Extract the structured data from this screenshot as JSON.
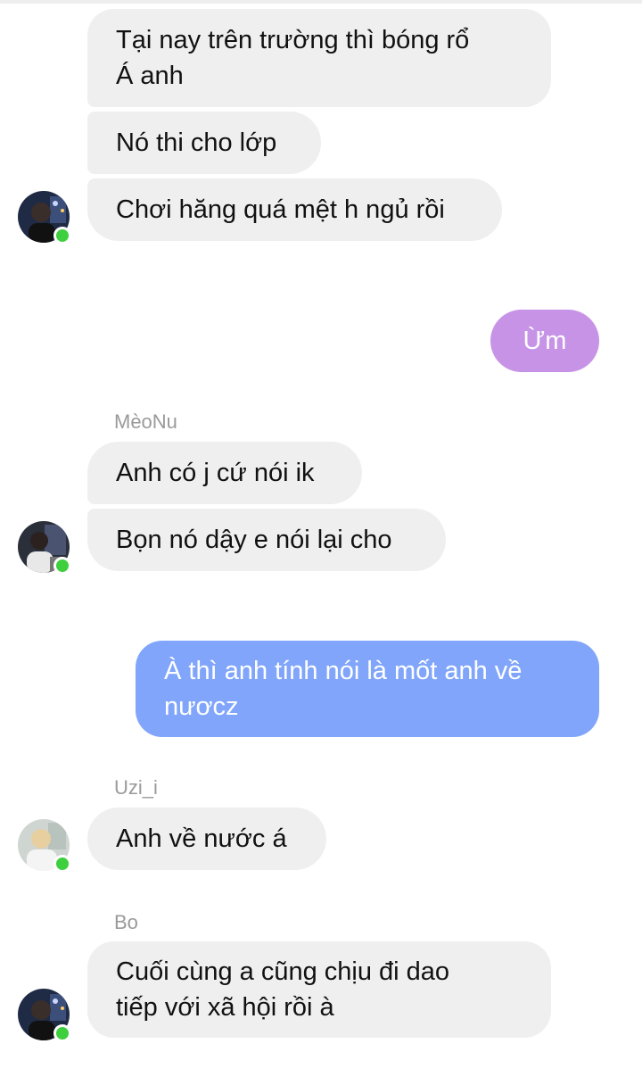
{
  "colors": {
    "incoming_bubble": "#efefef",
    "outgoing_purple": "#c793e6",
    "outgoing_blue": "#80a5fa",
    "online_dot": "#3ecf3e",
    "sender_name": "#9a9a9a"
  },
  "messages": {
    "m1": {
      "line1": "Tại nay trên trường thì bóng rổ",
      "line2": "Á anh"
    },
    "m2": {
      "text": "Nó thi cho lớp"
    },
    "m3": {
      "text": "Chơi hăng quá mệt h ngủ rồi"
    },
    "m4": {
      "text": "Ừm"
    },
    "m5": {
      "sender": "MèoNu",
      "text": "Anh có j cứ nói ik"
    },
    "m6": {
      "text": "Bọn nó dậy e nói lại cho"
    },
    "m7": {
      "line1": "À thì anh tính nói là mốt anh về",
      "line2": "nươcz"
    },
    "m8": {
      "sender": "Uzi_i",
      "text": "Anh về nước á"
    },
    "m9": {
      "sender": "Bo",
      "line1": "Cuối cùng a cũng chịu đi dao",
      "line2": "tiếp với xã hội rồi à"
    }
  },
  "avatars": {
    "a1": {
      "icon": "avatar-photo-dark",
      "online": true
    },
    "a2": {
      "icon": "avatar-photo-dark",
      "online": true
    },
    "a3": {
      "icon": "avatar-photo-light",
      "online": true
    },
    "a4": {
      "icon": "avatar-photo-dark",
      "online": true
    }
  }
}
